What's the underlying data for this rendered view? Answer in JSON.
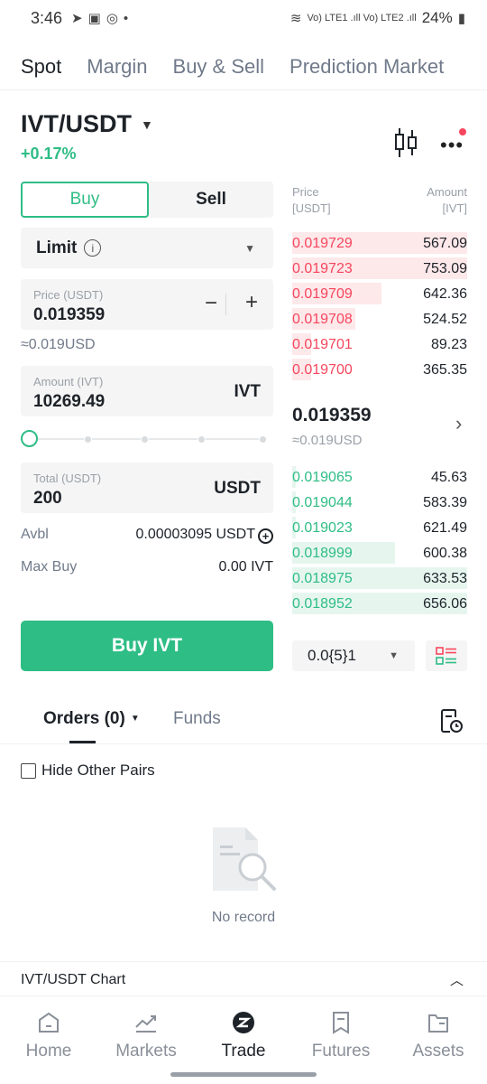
{
  "status_bar": {
    "time": "3:46",
    "battery": "24%",
    "network": "Vo) LTE1 .ıll Vo) LTE2 .ıll"
  },
  "top_tabs": [
    {
      "label": "Spot",
      "active": true
    },
    {
      "label": "Margin",
      "active": false
    },
    {
      "label": "Buy & Sell",
      "active": false
    },
    {
      "label": "Prediction Market",
      "active": false
    }
  ],
  "pair": {
    "symbol": "IVT/USDT",
    "change": "+0.17%"
  },
  "order_form": {
    "buy_label": "Buy",
    "sell_label": "Sell",
    "order_type": "Limit",
    "price_label": "Price (USDT)",
    "price_value": "0.019359",
    "price_approx": "≈0.019USD",
    "amount_label": "Amount (IVT)",
    "amount_value": "10269.49",
    "amount_unit": "IVT",
    "slider_fraction": 0,
    "total_label": "Total (USDT)",
    "total_value": "200",
    "total_unit": "USDT",
    "avbl_label": "Avbl",
    "avbl_value": "0.00003095 USDT",
    "maxbuy_label": "Max Buy",
    "maxbuy_value": "0.00 IVT",
    "submit_label": "Buy IVT"
  },
  "orderbook": {
    "price_header": "Price",
    "price_header_unit": "[USDT]",
    "amount_header": "Amount",
    "amount_header_unit": "[IVT]",
    "asks": [
      {
        "price": "0.019729",
        "amount": "567.09",
        "depth": 1.0
      },
      {
        "price": "0.019723",
        "amount": "753.09",
        "depth": 1.0
      },
      {
        "price": "0.019709",
        "amount": "642.36",
        "depth": 0.51
      },
      {
        "price": "0.019708",
        "amount": "524.52",
        "depth": 0.36
      },
      {
        "price": "0.019701",
        "amount": "89.23",
        "depth": 0.11
      },
      {
        "price": "0.019700",
        "amount": "365.35",
        "depth": 0.11
      }
    ],
    "mid_price": "0.019359",
    "mid_approx": "≈0.019USD",
    "bids": [
      {
        "price": "0.019065",
        "amount": "45.63",
        "depth": 0.02
      },
      {
        "price": "0.019044",
        "amount": "583.39",
        "depth": 0.02
      },
      {
        "price": "0.019023",
        "amount": "621.49",
        "depth": 0.02
      },
      {
        "price": "0.018999",
        "amount": "600.38",
        "depth": 0.59
      },
      {
        "price": "0.018975",
        "amount": "633.53",
        "depth": 1.0
      },
      {
        "price": "0.018952",
        "amount": "656.06",
        "depth": 1.0
      }
    ],
    "precision": "0.0{5}1"
  },
  "orders": {
    "tab_orders": "Orders (0)",
    "tab_funds": "Funds",
    "hide_other_pairs": "Hide Other Pairs",
    "empty_text": "No record"
  },
  "chart_bar": {
    "title": "IVT/USDT Chart"
  },
  "bottom_nav": [
    {
      "label": "Home",
      "icon": "home-icon",
      "active": false
    },
    {
      "label": "Markets",
      "icon": "markets-icon",
      "active": false
    },
    {
      "label": "Trade",
      "icon": "trade-icon",
      "active": true
    },
    {
      "label": "Futures",
      "icon": "futures-icon",
      "active": false
    },
    {
      "label": "Assets",
      "icon": "assets-icon",
      "active": false
    }
  ],
  "colors": {
    "green": "#2ebd85",
    "red": "#f6465d",
    "text": "#1e2329",
    "muted": "#707a8a"
  }
}
